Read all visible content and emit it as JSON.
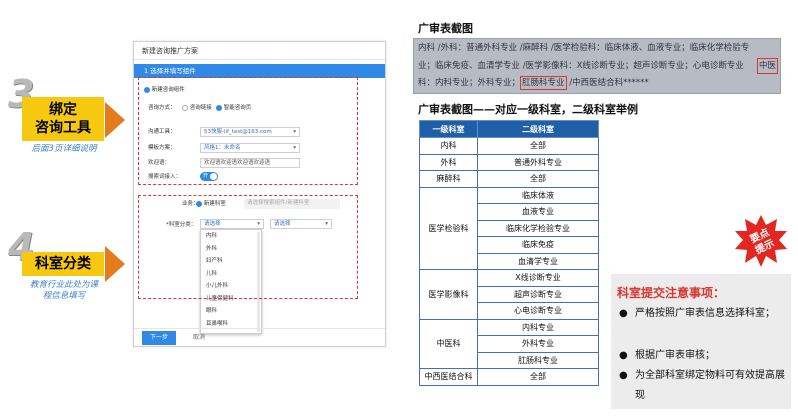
{
  "steps": [
    {
      "num": "3",
      "label": "绑定\n咨询工具",
      "label_lines": [
        "绑定",
        "咨询工具"
      ],
      "note_lines": [
        "后面3页详细说明"
      ]
    },
    {
      "num": "4",
      "label": "科室分类",
      "label_lines": [
        "科室分类"
      ],
      "note_lines": [
        "教育行业此处为课",
        "程信息填写"
      ]
    }
  ],
  "form": {
    "title": "新建咨询推广方案",
    "section_bar": "1 选择并填写组件",
    "component_label": "新建咨询组件",
    "consult_mode_label": "咨询方式：",
    "consult_mode_options": [
      "咨询链接",
      "智能咨询页"
    ],
    "tool_label": "沟通工具：",
    "tool_value": "53快服-lif_test@163.com",
    "template_label": "模板方案：",
    "template_value": "风格1：未命名",
    "welcome_label": "欢迎语：",
    "welcome_value": "欢迎语欢迎语欢迎语欢迎语",
    "search_label": "搜索词接入：",
    "toggle_label": "开",
    "business_label": "业务：",
    "business_value": "新建科室",
    "business_placeholder": "请选择搜索组件/新建科室",
    "dept_label": "*科室分类：",
    "dept_select_1": "请选择",
    "dept_select_2": "请选择",
    "dropdown_items": [
      "内科",
      "外科",
      "妇产科",
      "儿科",
      "小儿外科",
      "儿童保健科",
      "眼科",
      "耳鼻喉科"
    ],
    "next_button": "下一步",
    "cancel_button": "取消"
  },
  "right": {
    "title1": "广审表截图",
    "screenshot_lines": [
      "内科  /外科：普通外科专业  /麻醉科  /医学检验科：临床体液、血液专业；临床化学检验专",
      "业；临床免疫、血清学专业  /医学影像科：X线诊断专业；超声诊断专业；心电诊断专业",
      "科：内科专业；外科专业；",
      "肛肠科专业",
      "  /中西医结合科******"
    ],
    "screenshot_redbox_tail": "中医",
    "title2": "广审表截图——对应一级科室，二级科室举例",
    "table_headers": [
      "一级科室",
      "二级科室"
    ],
    "table_rows": [
      {
        "primary": "内科",
        "secondary": [
          "全部"
        ]
      },
      {
        "primary": "外科",
        "secondary": [
          "普通外科专业"
        ]
      },
      {
        "primary": "麻醉科",
        "secondary": [
          "全部"
        ]
      },
      {
        "primary": "医学检验科",
        "secondary": [
          "临床体液",
          "血液专业",
          "临床化学检验专业",
          "临床免疫",
          "血清学专业"
        ]
      },
      {
        "primary": "医学影像科",
        "secondary": [
          "X线诊断专业",
          "超声诊断专业",
          "心电诊断专业"
        ]
      },
      {
        "primary": "中医科",
        "secondary": [
          "内科专业",
          "外科专业",
          "肛肠科专业"
        ]
      },
      {
        "primary": "中西医结合科",
        "secondary": [
          "全部"
        ]
      }
    ],
    "burst_lines": [
      "要点",
      "提示"
    ],
    "notes_title": "科室提交注意事项：",
    "notes": [
      "严格按照广审表信息选择科室；",
      "根据广审表审核；",
      "为全部科室绑定物料可有效提高展现"
    ]
  },
  "colors": {
    "accent_blue": "#2f89e6",
    "orange": "#e57a1e",
    "yellow": "#f6c80f",
    "red": "#d9382f",
    "table_header": "#1f5fa8"
  },
  "icons": [
    "arrow-right-icon",
    "radio-icon",
    "dropdown-caret-icon",
    "toggle-icon",
    "bullet-icon",
    "burst-badge-icon"
  ]
}
